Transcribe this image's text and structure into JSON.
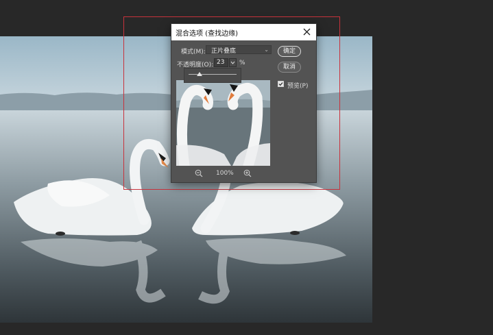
{
  "dialog": {
    "title": "混合选项 (查找边缘)",
    "mode_label": "模式(M):",
    "mode_value": "正片叠底",
    "opacity_label": "不透明度(O):",
    "opacity_value": "23",
    "opacity_unit": "%",
    "opacity_slider_value": 23,
    "zoom_level": "100%",
    "ok_label": "确定",
    "cancel_label": "取消",
    "preview_label": "预览(P)",
    "preview_checked": true
  },
  "icons": {
    "close": "close-icon",
    "zoom_out": "zoom-out-icon",
    "zoom_in": "zoom-in-icon",
    "checkmark": "checkmark-icon",
    "dropdown": "chevron-down-icon"
  },
  "colors": {
    "app_background": "#282828",
    "dialog_background": "#535353",
    "selection_border": "#c8323c",
    "title_bar": "#ffffff"
  }
}
